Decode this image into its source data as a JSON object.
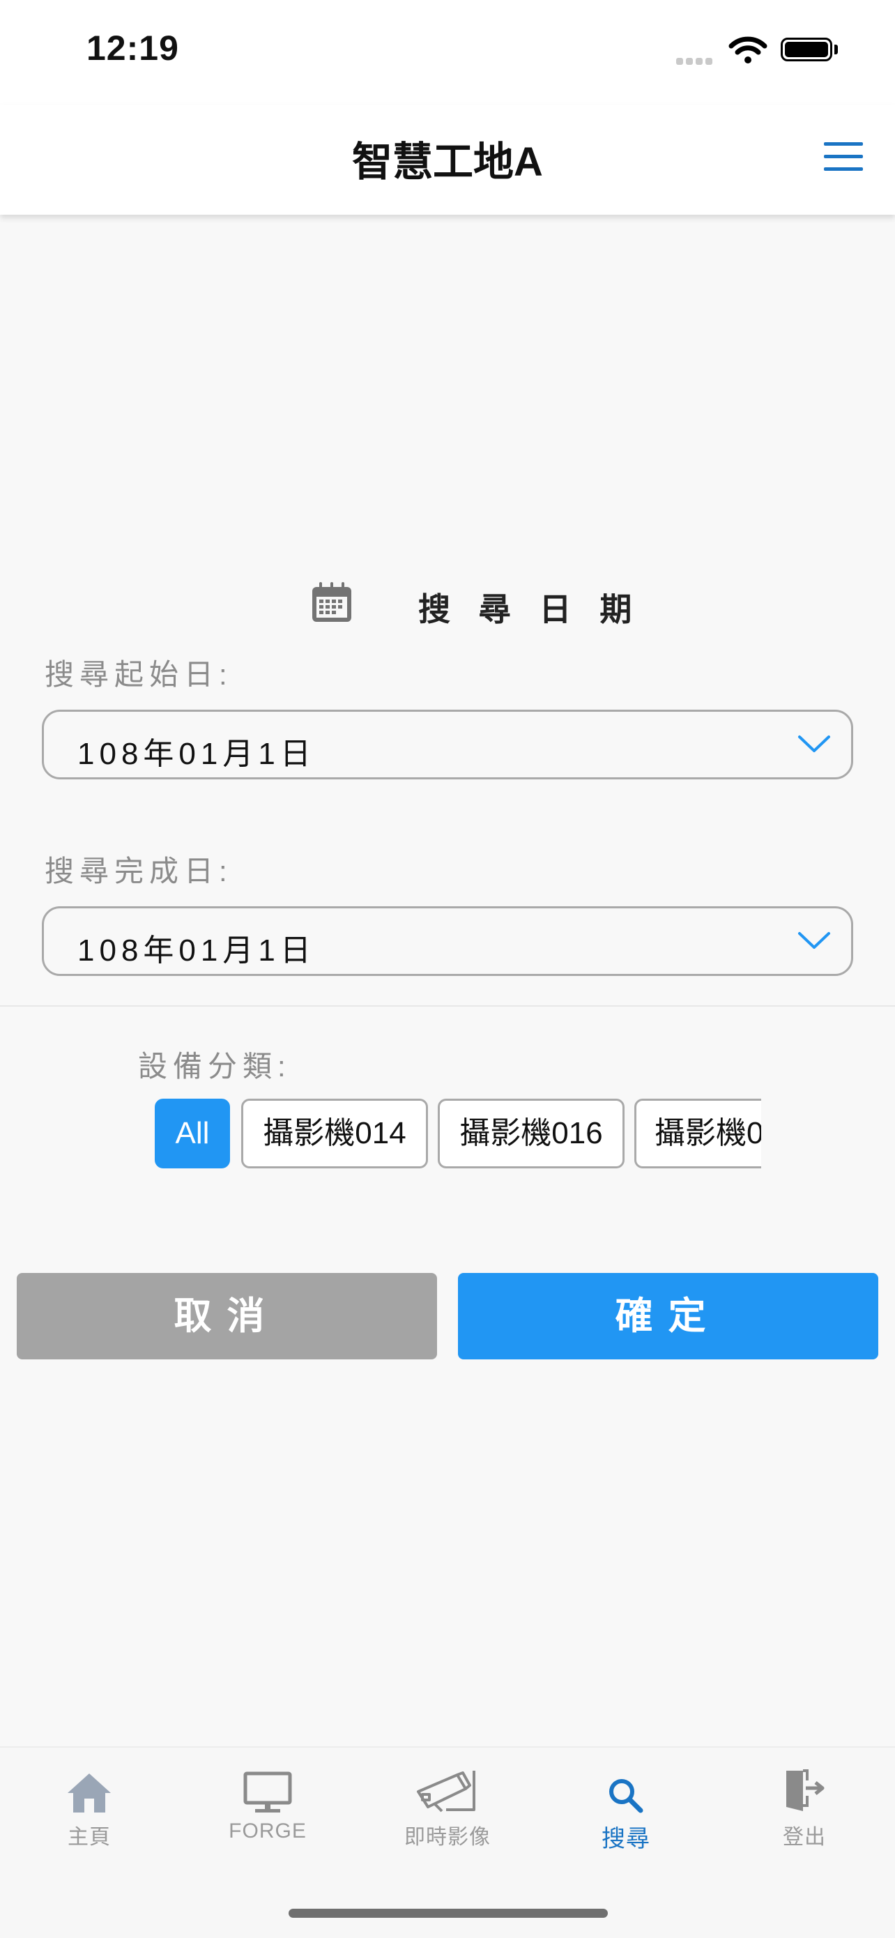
{
  "status_bar": {
    "time": "12:19"
  },
  "header": {
    "title": "智慧工地A",
    "menu_icon": "hamburger-menu-icon"
  },
  "date_section": {
    "title": "搜 尋 日 期",
    "icon": "calendar-icon",
    "start": {
      "label": "搜尋起始日:",
      "value": "108年01月1日"
    },
    "end": {
      "label": "搜尋完成日:",
      "value": "108年01月1日"
    }
  },
  "device_category": {
    "label": "設備分類:",
    "chips": [
      {
        "label": "All",
        "selected": true
      },
      {
        "label": "攝影機014",
        "selected": false
      },
      {
        "label": "攝影機016",
        "selected": false
      },
      {
        "label": "攝影機0",
        "selected": false
      }
    ]
  },
  "actions": {
    "cancel": "取消",
    "confirm": "確定"
  },
  "tabs": [
    {
      "label": "主頁",
      "icon": "home-icon",
      "active": false
    },
    {
      "label": "FORGE",
      "icon": "monitor-icon",
      "active": false
    },
    {
      "label": "即時影像",
      "icon": "security-camera-icon",
      "active": false
    },
    {
      "label": "搜尋",
      "icon": "search-icon",
      "active": true
    },
    {
      "label": "登出",
      "icon": "logout-door-icon",
      "active": false
    }
  ],
  "colors": {
    "accent": "#2196f3",
    "header_icon": "#1a74c4",
    "cancel_gray": "#a4a4a4"
  }
}
